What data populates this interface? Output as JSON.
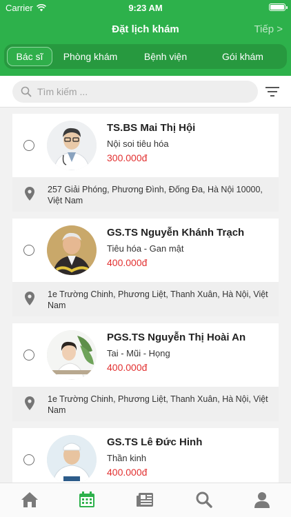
{
  "status": {
    "carrier": "Carrier",
    "time": "9:23 AM"
  },
  "nav": {
    "title": "Đặt lịch khám",
    "next": "Tiếp >"
  },
  "tabs": [
    "Bác sĩ",
    "Phòng khám",
    "Bệnh viện",
    "Gói khám"
  ],
  "search": {
    "placeholder": "Tìm kiếm ..."
  },
  "doctors": [
    {
      "name": "TS.BS Mai Thị Hội",
      "specialty": "Nội soi tiêu hóa",
      "price": "300.000đ",
      "address": "257 Giải Phóng, Phương Đình, Đống Đa, Hà Nội 10000, Việt Nam"
    },
    {
      "name": "GS.TS Nguyễn Khánh Trạch",
      "specialty": "Tiêu hóa - Gan mật",
      "price": "400.000đ",
      "address": "1e Trường Chinh, Phương Liệt, Thanh Xuân, Hà Nội, Việt Nam"
    },
    {
      "name": "PGS.TS Nguyễn Thị Hoài An",
      "specialty": "Tai - Mũi - Họng",
      "price": "400.000đ",
      "address": "1e Trường Chinh, Phương Liệt, Thanh Xuân, Hà Nội, Việt Nam"
    },
    {
      "name": "GS.TS Lê Đức Hinh",
      "specialty": "Thần kinh",
      "price": "400.000đ",
      "address": ""
    }
  ],
  "colors": {
    "primary": "#2db14b",
    "price": "#e23030"
  },
  "tabbar": [
    "home-icon",
    "calendar-icon",
    "news-icon",
    "search-icon",
    "profile-icon"
  ]
}
